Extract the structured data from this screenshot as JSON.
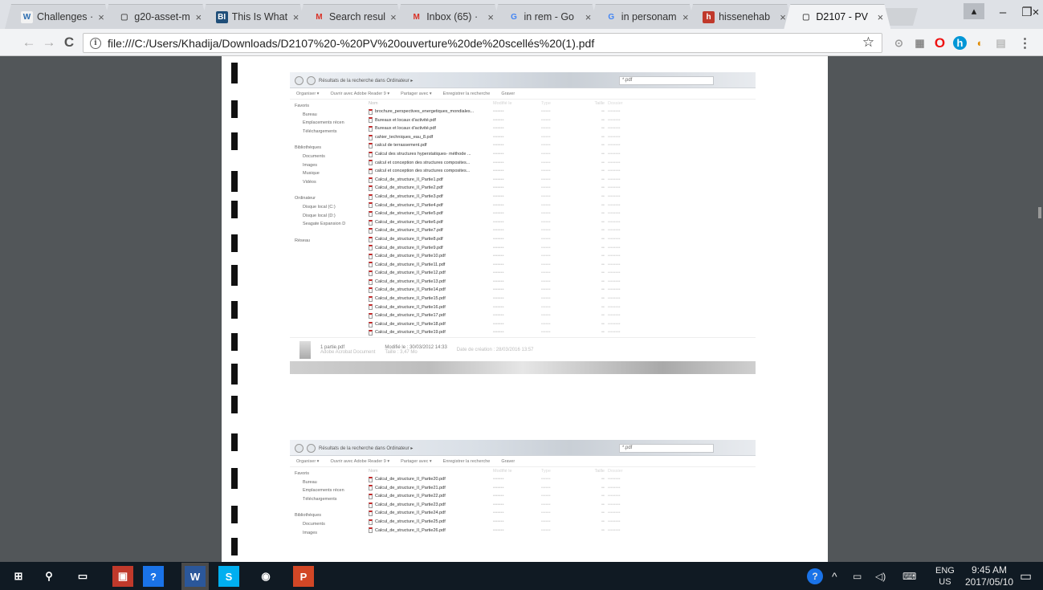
{
  "tabs": [
    {
      "title": "Challenges ·",
      "icon": "W",
      "icon_name": "w-icon",
      "icon_color": "#f2f2f2",
      "icon_fg": "#2b6cb0"
    },
    {
      "title": "g20-asset-m",
      "icon": "▢",
      "icon_name": "document-icon",
      "icon_color": "transparent",
      "icon_fg": "#555"
    },
    {
      "title": "This Is What",
      "icon": "BI",
      "icon_name": "bi-logo-icon",
      "icon_color": "#1f4e79",
      "icon_fg": "#fff"
    },
    {
      "title": "Search resul",
      "icon": "M",
      "icon_name": "gmail-icon",
      "icon_color": "transparent",
      "icon_fg": "#d93025"
    },
    {
      "title": "Inbox (65) ·",
      "icon": "M",
      "icon_name": "gmail-icon",
      "icon_color": "transparent",
      "icon_fg": "#d93025"
    },
    {
      "title": "in rem - Go",
      "icon": "G",
      "icon_name": "google-icon",
      "icon_color": "transparent",
      "icon_fg": "#4285f4"
    },
    {
      "title": "in personam",
      "icon": "G",
      "icon_name": "google-icon",
      "icon_color": "transparent",
      "icon_fg": "#4285f4"
    },
    {
      "title": "hissenehab",
      "icon": "h",
      "icon_name": "site-icon",
      "icon_color": "#c0392b",
      "icon_fg": "#fff"
    },
    {
      "title": "D2107 - PV",
      "icon": "▢",
      "icon_name": "document-icon",
      "icon_color": "transparent",
      "icon_fg": "#555",
      "active": true
    }
  ],
  "window_controls": {
    "minimize": "–",
    "maximize": "❐",
    "close": "×"
  },
  "toolbar": {
    "back": "←",
    "forward": "→",
    "reload": "C",
    "url": "file:///C:/Users/Khadija/Downloads/D2107%20-%20PV%20ouverture%20de%20scellés%20(1).pdf",
    "info": "i",
    "star": "☆",
    "menu": "⋮"
  },
  "pdf": {
    "shot1": {
      "address": "Résultats de la recherche dans Ordinateur ▸",
      "search": "*.pdf",
      "commands": [
        "Organiser ▾",
        "Ouvrir avec Adobe Reader 9 ▾",
        "Partager avec ▾",
        "Enregistrer la recherche",
        "Graver"
      ],
      "nav": [
        {
          "label": "Favoris",
          "type": "head"
        },
        {
          "label": "Bureau",
          "type": "sub"
        },
        {
          "label": "Emplacements récen",
          "type": "sub"
        },
        {
          "label": "Téléchargements",
          "type": "sub"
        },
        {
          "label": "",
          "type": "gap"
        },
        {
          "label": "Bibliothèques",
          "type": "head"
        },
        {
          "label": "Documents",
          "type": "sub"
        },
        {
          "label": "Images",
          "type": "sub"
        },
        {
          "label": "Musique",
          "type": "sub"
        },
        {
          "label": "Vidéos",
          "type": "sub"
        },
        {
          "label": "",
          "type": "gap"
        },
        {
          "label": "Ordinateur",
          "type": "head"
        },
        {
          "label": "Disque local (C:)",
          "type": "sub"
        },
        {
          "label": "Disque local (D:)",
          "type": "sub"
        },
        {
          "label": "Seagate Expansion D",
          "type": "sub"
        },
        {
          "label": "",
          "type": "gap"
        },
        {
          "label": "Réseau",
          "type": "head"
        }
      ],
      "columns": [
        "Nom",
        "Modifié le",
        "Type",
        "Taille",
        "Dossier"
      ],
      "files": [
        "brochure_perspectives_energetiques_mondiales...",
        "Bureaux et locaux d'activité.pdf",
        "Bureaux et locaux d'activité.pdf",
        "cahier_techniques_eau_8.pdf",
        "calcul de terrassement.pdf",
        "Calcul des structures hyperstatiques- méthode ...",
        "calcul et conception des structures composites...",
        "calcul et conception des structures composites...",
        "Calcul_de_structure_II_Partie1.pdf",
        "Calcul_de_structure_II_Partie2.pdf",
        "Calcul_de_structure_II_Partie3.pdf",
        "Calcul_de_structure_II_Partie4.pdf",
        "Calcul_de_structure_II_Partie5.pdf",
        "Calcul_de_structure_II_Partie6.pdf",
        "Calcul_de_structure_II_Partie7.pdf",
        "Calcul_de_structure_II_Partie8.pdf",
        "Calcul_de_structure_II_Partie9.pdf",
        "Calcul_de_structure_II_Partie10.pdf",
        "Calcul_de_structure_II_Partie11.pdf",
        "Calcul_de_structure_II_Partie12.pdf",
        "Calcul_de_structure_II_Partie13.pdf",
        "Calcul_de_structure_II_Partie14.pdf",
        "Calcul_de_structure_II_Partie15.pdf",
        "Calcul_de_structure_II_Partie16.pdf",
        "Calcul_de_structure_II_Partie17.pdf",
        "Calcul_de_structure_II_Partie18.pdf",
        "Calcul_de_structure_II_Partie19.pdf"
      ],
      "details": {
        "name": "1 partie.pdf",
        "modified": "Modifié le : 30/03/2012 14:33",
        "created": "Date de création : 28/03/2016 13:57",
        "type": "Adobe Acrobat Document",
        "size": "Taille : 3,47 Mo"
      }
    },
    "shot2": {
      "address": "Résultats de la recherche dans Ordinateur ▸",
      "search": "*.pdf",
      "commands": [
        "Organiser ▾",
        "Ouvrir avec Adobe Reader 9 ▾",
        "Partager avec ▾",
        "Enregistrer la recherche",
        "Graver"
      ],
      "nav": [
        {
          "label": "Favoris",
          "type": "head"
        },
        {
          "label": "Bureau",
          "type": "sub"
        },
        {
          "label": "Emplacements récen",
          "type": "sub"
        },
        {
          "label": "Téléchargements",
          "type": "sub"
        },
        {
          "label": "",
          "type": "gap"
        },
        {
          "label": "Bibliothèques",
          "type": "head"
        },
        {
          "label": "Documents",
          "type": "sub"
        },
        {
          "label": "Images",
          "type": "sub"
        }
      ],
      "columns": [
        "Nom",
        "Modifié le",
        "Type",
        "Taille",
        "Dossier"
      ],
      "files": [
        "Calcul_de_structure_II_Partie20.pdf",
        "Calcul_de_structure_II_Partie21.pdf",
        "Calcul_de_structure_II_Partie22.pdf",
        "Calcul_de_structure_II_Partie23.pdf",
        "Calcul_de_structure_II_Partie24.pdf",
        "Calcul_de_structure_II_Partie25.pdf",
        "Calcul_de_structure_II_Partie26.pdf"
      ]
    }
  },
  "taskbar": {
    "apps": [
      {
        "name": "start-icon",
        "glyph": "⊞",
        "bg": "transparent"
      },
      {
        "name": "search-icon",
        "glyph": "⚲",
        "bg": "transparent"
      },
      {
        "name": "task-view-icon",
        "glyph": "▭",
        "bg": "transparent"
      },
      {
        "name": "store-icon",
        "glyph": "▣",
        "bg": "#c0392b"
      },
      {
        "name": "help-icon",
        "glyph": "?",
        "bg": "#1a73e8"
      },
      {
        "name": "word-icon",
        "glyph": "W",
        "bg": "#2b579a"
      },
      {
        "name": "skype-icon",
        "glyph": "S",
        "bg": "#00aff0"
      },
      {
        "name": "chrome-icon",
        "glyph": "◉",
        "bg": "transparent"
      },
      {
        "name": "powerpoint-icon",
        "glyph": "P",
        "bg": "#d24726"
      }
    ],
    "lang": "ENG",
    "region": "US",
    "time": "9:45 AM",
    "date": "2017/05/10"
  }
}
